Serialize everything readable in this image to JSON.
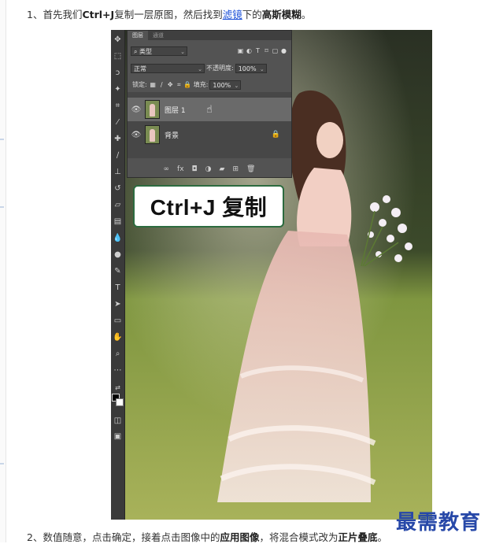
{
  "step1": {
    "prefix": "1、首先我们",
    "bold1": "Ctrl+J",
    "mid1": "复制一层原图，然后找到",
    "link": "滤镜",
    "mid2": "下的",
    "bold2": "高斯模糊",
    "end": "。"
  },
  "step2": {
    "prefix": "2、数值随意，点击确定，接着点击图像中的",
    "bold1": "应用图像",
    "mid": "，将混合模式改为",
    "bold2": "正片叠底",
    "end": "。"
  },
  "screenshot": {
    "panel_tabs": [
      "图层",
      "通道"
    ],
    "filter_kind": "类型",
    "blend_mode": "正常",
    "opacity_label": "不透明度:",
    "opacity_value": "100%",
    "lock_label": "锁定:",
    "fill_label": "填充:",
    "fill_value": "100%",
    "layers": [
      {
        "name": "图层 1",
        "active": true
      },
      {
        "name": "背景",
        "active": false,
        "locked": true
      }
    ],
    "callout_text": "Ctrl+J 复制"
  },
  "watermark": "最需教育",
  "colors": {
    "link": "#1a4fd8",
    "callout_border": "#2c6b3f",
    "watermark": "#2748a8",
    "panel_bg": "#535353"
  }
}
